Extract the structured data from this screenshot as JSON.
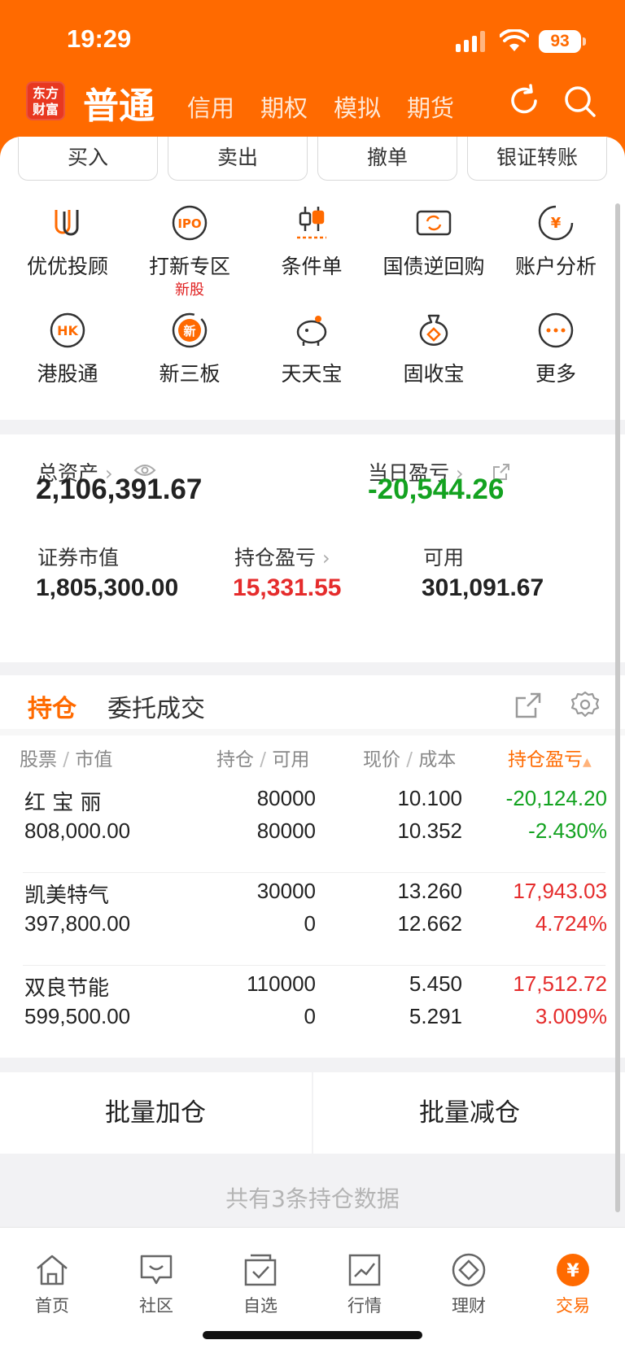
{
  "status_bar": {
    "time": "19:29",
    "battery": "93"
  },
  "nav": {
    "logo_line1": "东方",
    "logo_line2": "财富",
    "active_tab": "普通",
    "tabs": [
      "信用",
      "期权",
      "模拟",
      "期货"
    ]
  },
  "actions": [
    "买入",
    "卖出",
    "撤单",
    "银证转账"
  ],
  "grid": [
    {
      "label": "优优投顾",
      "icon": "uu-advisor-icon"
    },
    {
      "label": "打新专区",
      "sub": "新股",
      "icon": "ipo-icon"
    },
    {
      "label": "条件单",
      "icon": "condition-order-icon"
    },
    {
      "label": "国债逆回购",
      "icon": "repo-icon"
    },
    {
      "label": "账户分析",
      "icon": "account-analysis-icon"
    },
    {
      "label": "港股通",
      "icon": "hk-icon"
    },
    {
      "label": "新三板",
      "icon": "neeq-icon"
    },
    {
      "label": "天天宝",
      "icon": "piggy-bank-icon"
    },
    {
      "label": "固收宝",
      "icon": "money-bag-icon"
    },
    {
      "label": "更多",
      "icon": "more-icon"
    }
  ],
  "assets": {
    "total_label": "总资产",
    "total_value": "2,106,391.67",
    "daily_pl_label": "当日盈亏",
    "daily_pl_value": "-20,544.26",
    "market_value_label": "证券市值",
    "market_value": "1,805,300.00",
    "position_pl_label": "持仓盈亏",
    "position_pl_value": "15,331.55",
    "available_label": "可用",
    "available_value": "301,091.67"
  },
  "positions": {
    "tab_active": "持仓",
    "tab_other": "委托成交",
    "headers": {
      "stock": "股票",
      "mv": "市值",
      "hold": "持仓",
      "avail": "可用",
      "price": "现价",
      "cost": "成本",
      "pl": "持仓盈亏"
    },
    "rows": [
      {
        "name": "红 宝 丽",
        "market_value": "808,000.00",
        "hold": "80000",
        "available": "80000",
        "price": "10.100",
        "cost": "10.352",
        "pl": "-20,124.20",
        "pl_pct": "-2.430%",
        "trend": "down"
      },
      {
        "name": "凯美特气",
        "market_value": "397,800.00",
        "hold": "30000",
        "available": "0",
        "price": "13.260",
        "cost": "12.662",
        "pl": "17,943.03",
        "pl_pct": "4.724%",
        "trend": "up"
      },
      {
        "name": "双良节能",
        "market_value": "599,500.00",
        "hold": "110000",
        "available": "0",
        "price": "5.450",
        "cost": "5.291",
        "pl": "17,512.72",
        "pl_pct": "3.009%",
        "trend": "up"
      }
    ]
  },
  "batch": {
    "add": "批量加仓",
    "reduce": "批量减仓"
  },
  "footer_note": "共有3条持仓数据",
  "tabbar": [
    {
      "label": "首页",
      "icon": "home-icon"
    },
    {
      "label": "社区",
      "icon": "community-icon"
    },
    {
      "label": "自选",
      "icon": "watchlist-icon"
    },
    {
      "label": "行情",
      "icon": "market-icon"
    },
    {
      "label": "理财",
      "icon": "wealth-icon"
    },
    {
      "label": "交易",
      "icon": "trade-icon",
      "active": true
    }
  ],
  "colors": {
    "brand": "#ff6a00",
    "up": "#e52c2c",
    "down": "#13a220"
  }
}
